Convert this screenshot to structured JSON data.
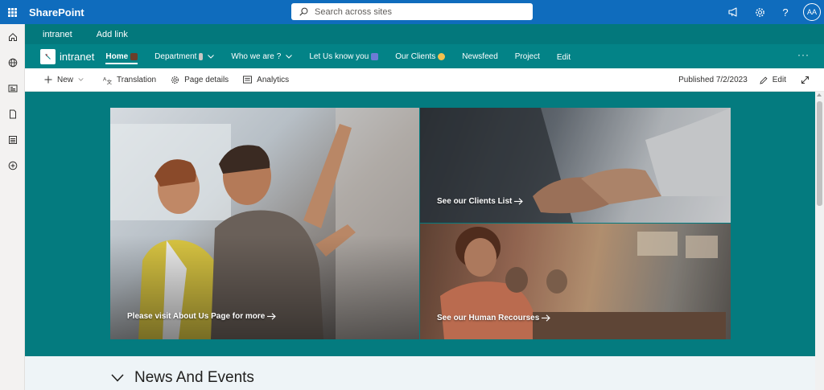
{
  "suite": {
    "brand": "SharePoint",
    "search_placeholder": "Search across sites",
    "avatar_initials": "AA",
    "icons": [
      "waffle-icon",
      "megaphone-icon",
      "gear-icon",
      "help-icon"
    ]
  },
  "app_bar": {
    "items": [
      "home-icon",
      "globe-icon",
      "news-icon",
      "document-icon",
      "list-icon",
      "add-icon"
    ]
  },
  "hub_nav": {
    "items": [
      {
        "label": "intranet"
      },
      {
        "label": "Add link"
      }
    ]
  },
  "site_header": {
    "title": "intranet",
    "more": "···",
    "nav": [
      {
        "label": "Home",
        "active": true,
        "emoji_color": "#6b3f2a",
        "has_chevron": false
      },
      {
        "label": "Department",
        "active": false,
        "emoji_color": "#c8c6c4",
        "has_chevron": true
      },
      {
        "label": "Who we are",
        "active": false,
        "emoji_color": "#ffffff",
        "has_chevron": true
      },
      {
        "label": "Let Us know you",
        "active": false,
        "emoji_color": "#6d7bd6",
        "has_chevron": false
      },
      {
        "label": "Our Clients",
        "active": false,
        "emoji_color": "#f2c14e",
        "has_chevron": false
      },
      {
        "label": "Newsfeed",
        "active": false,
        "emoji_color": "",
        "has_chevron": false
      },
      {
        "label": "Project",
        "active": false,
        "emoji_color": "",
        "has_chevron": false
      },
      {
        "label": "Edit",
        "active": false,
        "emoji_color": "",
        "has_chevron": false
      }
    ]
  },
  "command_bar": {
    "new_label": "New",
    "translation_label": "Translation",
    "page_details_label": "Page details",
    "analytics_label": "Analytics",
    "published_label": "Published 7/2/2023",
    "edit_label": "Edit"
  },
  "hero": {
    "tiles": [
      {
        "label": "Please visit About Us Page for more"
      },
      {
        "label": "See our Clients List"
      },
      {
        "label": "See our Human Recourses"
      }
    ]
  },
  "news": {
    "heading": "News And Events"
  },
  "colors": {
    "suite_blue": "#0f6cbd",
    "hub_teal": "#03787c",
    "site_teal": "#038387",
    "hero_bg": "#047b7f"
  }
}
